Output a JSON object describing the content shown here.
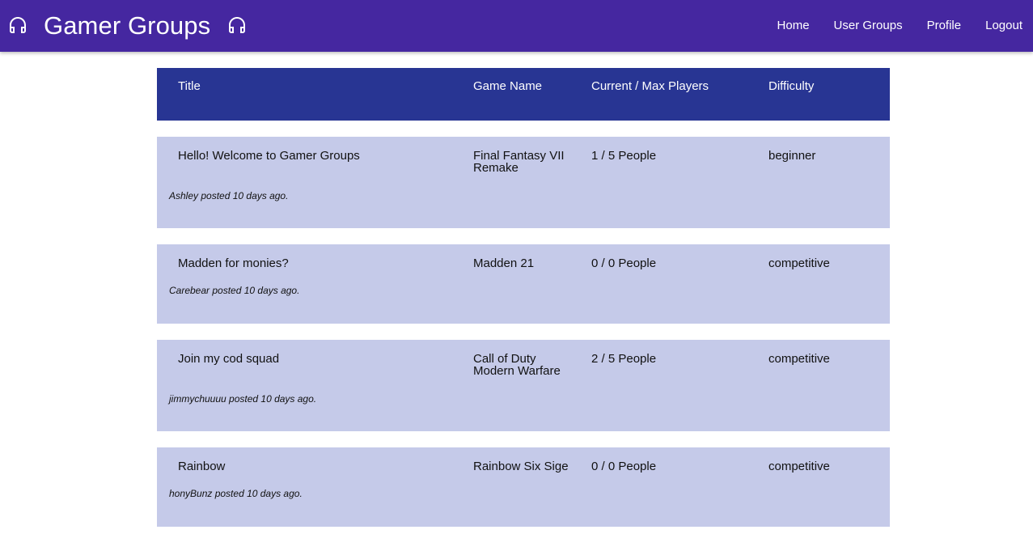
{
  "nav": {
    "brand": "Gamer Groups",
    "left_icon": "headphones-icon",
    "right_icon": "headphones-icon",
    "links": [
      "Home",
      "User Groups",
      "Profile",
      "Logout"
    ]
  },
  "table": {
    "headers": {
      "title": "Title",
      "game": "Game Name",
      "players": "Current / Max Players",
      "difficulty": "Difficulty"
    },
    "rows": [
      {
        "title": "Hello! Welcome to Gamer Groups",
        "game": "Final Fantasy VII Remake",
        "players": "1 / 5 People",
        "difficulty": "beginner",
        "byline": "Ashley posted 10 days ago."
      },
      {
        "title": "Madden for monies?",
        "game": "Madden 21",
        "players": "0 / 0 People",
        "difficulty": "competitive",
        "byline": "Carebear posted 10 days ago."
      },
      {
        "title": "Join my cod squad",
        "game": "Call of Duty Modern Warfare",
        "players": "2 / 5 People",
        "difficulty": "competitive",
        "byline": "jimmychuuuu posted 10 days ago."
      },
      {
        "title": "Rainbow",
        "game": "Rainbow Six Sige",
        "players": "0 / 0 People",
        "difficulty": "competitive",
        "byline": "honyBunz posted 10 days ago."
      }
    ]
  },
  "colors": {
    "navbar": "#4527a0",
    "table_header": "#283593",
    "row_bg": "#c5cae9"
  }
}
